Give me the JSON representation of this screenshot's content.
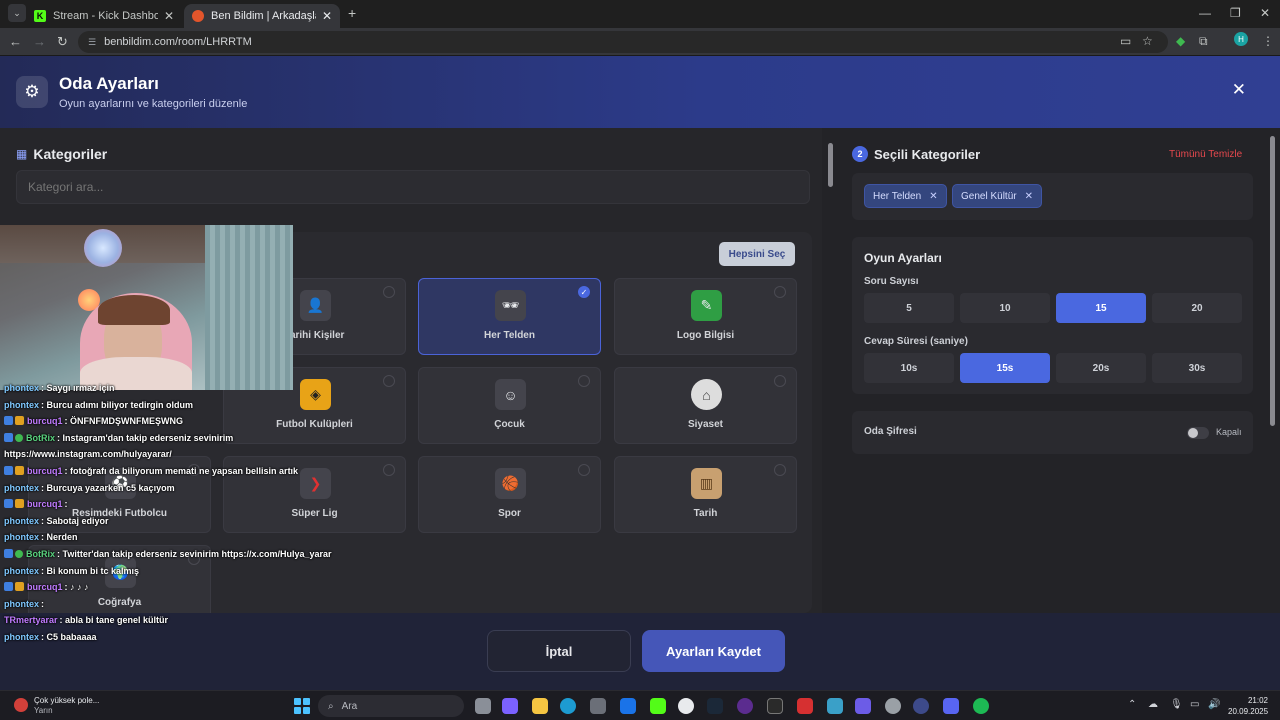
{
  "browser": {
    "tabs": [
      {
        "title": "Stream - Kick Dashboard",
        "favicon": "K",
        "color": "#53fc18"
      },
      {
        "title": "Ben Bildim | Arkadaşlarınla Onl",
        "favicon": "",
        "color": "#e3552b"
      }
    ],
    "new_tab": "+",
    "url": "benbildim.com/room/LHRRTM",
    "profile_initial": "H"
  },
  "modal": {
    "title": "Oda Ayarları",
    "subtitle": "Oyun ayarlarını ve kategorileri düzenle"
  },
  "categories": {
    "heading": "Kategoriler",
    "search_placeholder": "Kategori ara...",
    "select_all": "Hepsini Seç",
    "items": [
      {
        "label": "Tarihi Kişiler",
        "selected": false,
        "icon": "portrait-icon"
      },
      {
        "label": "Her Telden",
        "selected": true,
        "icon": "mixed-icon"
      },
      {
        "label": "Logo Bilgisi",
        "selected": false,
        "icon": "logo-icon"
      },
      {
        "label": "Futbol Kulüpleri",
        "selected": false,
        "icon": "wolf-crest-icon"
      },
      {
        "label": "Çocuk",
        "selected": false,
        "icon": "child-icon"
      },
      {
        "label": "Siyaset",
        "selected": false,
        "icon": "capitol-icon"
      },
      {
        "label": "Resimdeki Futbolcu",
        "selected": false,
        "icon": "footballer-icon"
      },
      {
        "label": "Süper Lig",
        "selected": false,
        "icon": "league-icon"
      },
      {
        "label": "Spor",
        "selected": false,
        "icon": "ball-icon"
      },
      {
        "label": "Tarih",
        "selected": false,
        "icon": "colosseum-icon"
      },
      {
        "label": "Coğrafya",
        "selected": false,
        "icon": "globe-icon"
      }
    ]
  },
  "selected": {
    "badge": "2",
    "heading": "Seçili Kategoriler",
    "clear_all": "Tümünü Temizle",
    "chips": [
      "Her Telden",
      "Genel Kültür"
    ]
  },
  "game_settings": {
    "heading": "Oyun Ayarları",
    "question_count_label": "Soru Sayısı",
    "question_count_options": [
      "5",
      "10",
      "15",
      "20"
    ],
    "question_count_selected": "15",
    "answer_time_label": "Cevap Süresi (saniye)",
    "answer_time_options": [
      "10s",
      "15s",
      "20s",
      "30s"
    ],
    "answer_time_selected": "15s"
  },
  "password": {
    "label": "Oda Şifresi",
    "state": "Kapalı"
  },
  "footer": {
    "cancel": "İptal",
    "save": "Ayarları Kaydet"
  },
  "chat": [
    {
      "user": "phontex",
      "text": ": Saygı ırmaz için",
      "color": "#7fc8ff"
    },
    {
      "user": "phontex",
      "text": ": Burcu adımı biliyor tedirgin oldum",
      "color": "#7fc8ff"
    },
    {
      "user": "burcuq1",
      "text": ": ÖNFNFMDŞWNFMEŞWNG",
      "color": "#c07bff",
      "badges": 2
    },
    {
      "user": "BotRix",
      "text": ": Instagram'dan takip ederseniz sevinirim",
      "color": "#59d27e",
      "badges": 3
    },
    {
      "user": "",
      "text": "https://www.instagram.com/hulyayarar/",
      "color": "#ffffff"
    },
    {
      "user": "burcuq1",
      "text": ": fotoğrafı da biliyorum memati ne yapsan bellisin artık",
      "color": "#c07bff",
      "badges": 2
    },
    {
      "user": "phontex",
      "text": ": Burcuya yazarken c5 kaçıyom",
      "color": "#7fc8ff"
    },
    {
      "user": "burcuq1",
      "text": ":",
      "color": "#c07bff",
      "badges": 2
    },
    {
      "user": "phontex",
      "text": ": Sabotaj ediyor",
      "color": "#7fc8ff"
    },
    {
      "user": "phontex",
      "text": ": Nerden",
      "color": "#7fc8ff"
    },
    {
      "user": "BotRix",
      "text": ": Twitter'dan takip ederseniz sevinirim https://x.com/Hulya_yarar",
      "color": "#59d27e",
      "badges": 3
    },
    {
      "user": "phontex",
      "text": ": Bi konum bi tc kalmış",
      "color": "#7fc8ff"
    },
    {
      "user": "burcuq1",
      "text": ": ♪ ♪ ♪",
      "color": "#c07bff",
      "badges": 2
    },
    {
      "user": "phontex",
      "text": ":",
      "color": "#7fc8ff"
    },
    {
      "user": "TRmertyarar",
      "text": ": abla bi tane genel kültür",
      "color": "#c07bff"
    },
    {
      "user": "phontex",
      "text": ": C5 babaaaa",
      "color": "#7fc8ff"
    }
  ],
  "taskbar": {
    "weather_title": "Çok yüksek pole...",
    "weather_sub": "Yarın",
    "search": "Ara",
    "time": "21:02",
    "date": "20.09.2025"
  }
}
